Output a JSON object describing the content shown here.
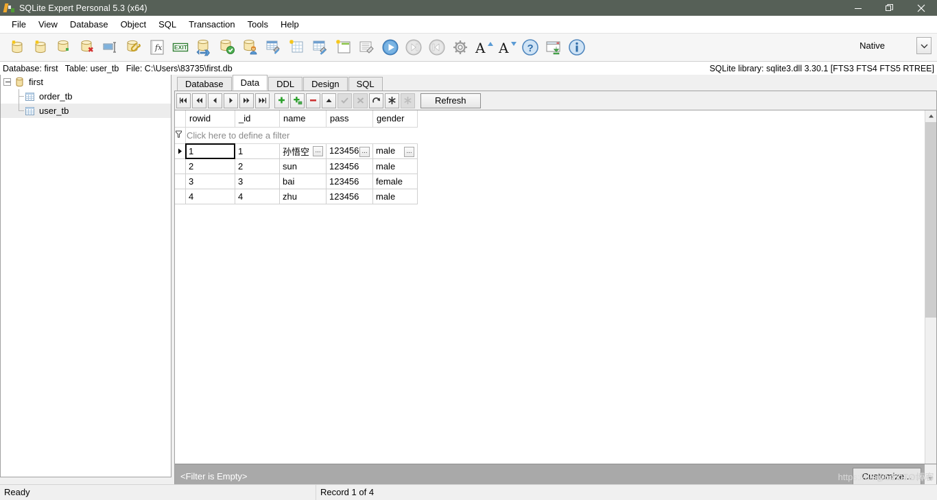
{
  "window": {
    "title": "SQLite Expert Personal 5.3 (x64)",
    "app_icon": "sqlite-expert-logo-icon",
    "controls": [
      {
        "name": "minimize-button",
        "icon": "minimize-icon"
      },
      {
        "name": "restore-button",
        "icon": "restore-icon"
      },
      {
        "name": "close-button",
        "icon": "close-icon"
      }
    ],
    "titlebar_color": "#566057"
  },
  "menubar": {
    "items": [
      {
        "label": "File"
      },
      {
        "label": "View"
      },
      {
        "label": "Database"
      },
      {
        "label": "Object"
      },
      {
        "label": "SQL"
      },
      {
        "label": "Transaction"
      },
      {
        "label": "Tools"
      },
      {
        "label": "Help"
      }
    ]
  },
  "toolbar": {
    "buttons": [
      {
        "name": "new-database-button",
        "icon": "database-new-icon"
      },
      {
        "name": "open-database-button",
        "icon": "database-open-icon"
      },
      {
        "name": "attach-database-button",
        "icon": "database-add-icon"
      },
      {
        "name": "detach-database-button",
        "icon": "database-delete-icon"
      },
      {
        "name": "rename-database-button",
        "icon": "rename-field-icon"
      },
      {
        "name": "database-properties-button",
        "icon": "database-attach-icon"
      },
      {
        "name": "function-button",
        "icon": "function-fx-icon"
      },
      {
        "name": "exit-button",
        "icon": "exit-icon"
      },
      {
        "name": "backup-database-button",
        "icon": "database-backup-icon"
      },
      {
        "name": "verify-database-button",
        "icon": "database-check-icon"
      },
      {
        "name": "database-user-button",
        "icon": "database-user-icon"
      },
      {
        "name": "table-tools-button",
        "icon": "table-tools-icon"
      },
      {
        "name": "new-table-button",
        "icon": "table-new-icon"
      },
      {
        "name": "edit-table-button",
        "icon": "table-edit-icon"
      },
      {
        "name": "new-view-button",
        "icon": "view-new-icon"
      },
      {
        "name": "edit-record-button",
        "icon": "record-edit-icon"
      },
      {
        "name": "execute-button",
        "icon": "play-icon"
      },
      {
        "name": "step-button",
        "icon": "step-forward-icon"
      },
      {
        "name": "stop-button",
        "icon": "step-back-icon"
      },
      {
        "name": "options-button",
        "icon": "gear-icon"
      },
      {
        "name": "increase-font-button",
        "icon": "font-increase-icon"
      },
      {
        "name": "decrease-font-button",
        "icon": "font-decrease-icon"
      },
      {
        "name": "help-button",
        "icon": "help-question-icon"
      },
      {
        "name": "check-updates-button",
        "icon": "window-download-icon"
      },
      {
        "name": "about-button",
        "icon": "info-icon"
      }
    ],
    "native_label": "Native",
    "native_dropdown_icon": "chevron-down-icon"
  },
  "infobar": {
    "left": "Database: first   Table: user_tb   File: C:\\Users\\83735\\first.db",
    "right": "SQLite library: sqlite3.dll 3.30.1 [FTS3 FTS4 FTS5 RTREE]"
  },
  "tree": {
    "root": {
      "label": "first",
      "icon": "database-icon"
    },
    "children": [
      {
        "label": "order_tb",
        "icon": "table-icon",
        "selected": false
      },
      {
        "label": "user_tb",
        "icon": "table-icon",
        "selected": true
      }
    ]
  },
  "tabs": [
    {
      "label": "Database",
      "active": false
    },
    {
      "label": "Data",
      "active": true
    },
    {
      "label": "DDL",
      "active": false
    },
    {
      "label": "Design",
      "active": false
    },
    {
      "label": "SQL",
      "active": false
    }
  ],
  "navbar": {
    "buttons": [
      {
        "name": "first-record-button",
        "icon": "skip-first-icon",
        "disabled": false
      },
      {
        "name": "prior-page-button",
        "icon": "rewind-icon",
        "disabled": false
      },
      {
        "name": "prior-record-button",
        "icon": "prev-icon",
        "disabled": false
      },
      {
        "name": "next-record-button",
        "icon": "next-icon",
        "disabled": false
      },
      {
        "name": "next-page-button",
        "icon": "fast-forward-icon",
        "disabled": false
      },
      {
        "name": "last-record-button",
        "icon": "skip-last-icon",
        "disabled": false
      },
      {
        "name": "insert-record-button",
        "icon": "plus-icon",
        "disabled": false
      },
      {
        "name": "duplicate-record-button",
        "icon": "plus-copy-icon",
        "disabled": false
      },
      {
        "name": "delete-record-button",
        "icon": "minus-icon",
        "disabled": false
      },
      {
        "name": "edit-record-button",
        "icon": "caret-up-icon",
        "disabled": false
      },
      {
        "name": "post-edit-button",
        "icon": "check-icon",
        "disabled": true
      },
      {
        "name": "cancel-edit-button",
        "icon": "cancel-x-icon",
        "disabled": true
      },
      {
        "name": "refresh-data-button",
        "icon": "refresh-arrow-icon",
        "disabled": false
      },
      {
        "name": "set-null-button",
        "icon": "asterisk-icon",
        "disabled": false
      },
      {
        "name": "clear-null-button",
        "icon": "asterisk-disabled-icon",
        "disabled": true
      }
    ],
    "refresh_label": "Refresh"
  },
  "grid": {
    "filter_row_label": "Click here to define a filter",
    "filter_icon": "filter-funnel-icon",
    "columns": [
      "rowid",
      "_id",
      "name",
      "pass",
      "gender"
    ],
    "rows": [
      {
        "rowid": "1",
        "_id": "1",
        "name": "孙悟空",
        "pass": "123456",
        "gender": "male",
        "current": true
      },
      {
        "rowid": "2",
        "_id": "2",
        "name": "sun",
        "pass": "123456",
        "gender": "male",
        "current": false
      },
      {
        "rowid": "3",
        "_id": "3",
        "name": "bai",
        "pass": "123456",
        "gender": "female",
        "current": false
      },
      {
        "rowid": "4",
        "_id": "4",
        "name": "zhu",
        "pass": "123456",
        "gender": "male",
        "current": false
      }
    ],
    "ellipsis_label": "...",
    "row_indicator_icon": "current-row-arrow-icon"
  },
  "filterbar": {
    "text": "<Filter is Empty>",
    "customize_label": "Customize...",
    "background_color": "#a9a9a9"
  },
  "statusbar": {
    "ready": "Ready",
    "record": "Record 1 of 4"
  },
  "watermark": {
    "url": "https://blog.csdn.net/wei",
    "tag": "@51CTO博客"
  }
}
